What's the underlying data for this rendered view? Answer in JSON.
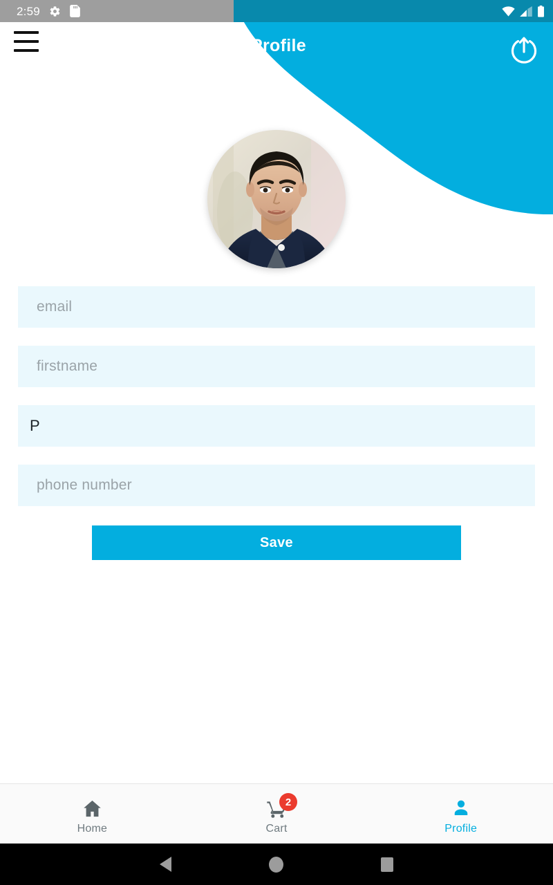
{
  "status_bar": {
    "clock": "2:59",
    "left_icons": [
      {
        "name": "settings-gear-icon",
        "glyph": "gear"
      },
      {
        "name": "sd-card-icon",
        "glyph": "sd-card"
      }
    ],
    "right_icons": [
      {
        "name": "wifi-icon",
        "glyph": "wifi"
      },
      {
        "name": "cellular-signal-icon",
        "glyph": "signal"
      },
      {
        "name": "battery-icon",
        "glyph": "battery"
      }
    ]
  },
  "app_bar": {
    "title": "Profile",
    "menu_icon": "hamburger-menu-icon",
    "logout_icon": "logout-power-icon"
  },
  "profile": {
    "avatar_alt": "user-avatar-photo"
  },
  "form": {
    "fields": [
      {
        "name": "email",
        "placeholder": "email",
        "value": ""
      },
      {
        "name": "firstname",
        "placeholder": "firstname",
        "value": ""
      },
      {
        "name": "lastname",
        "placeholder": "",
        "value": "P"
      },
      {
        "name": "phone",
        "placeholder": "phone number",
        "value": ""
      }
    ],
    "save_label": "Save"
  },
  "bottom_nav": {
    "items": [
      {
        "label": "Home",
        "icon": "home-icon",
        "active": false,
        "badge": ""
      },
      {
        "label": "Cart",
        "icon": "cart-icon",
        "active": false,
        "badge": "2"
      },
      {
        "label": "Profile",
        "icon": "person-icon",
        "active": true,
        "badge": ""
      }
    ]
  },
  "system_nav": {
    "back": "back-triangle-icon",
    "home": "home-circle-icon",
    "recents": "recents-square-icon"
  },
  "colors": {
    "accent": "#03aedf",
    "status_bar_tinted": "#0889ac",
    "status_bar_gray": "#9e9e9e",
    "field_bg": "#eaf8fd",
    "badge_red": "#eb3b2e",
    "nav_inactive": "#707b80"
  }
}
